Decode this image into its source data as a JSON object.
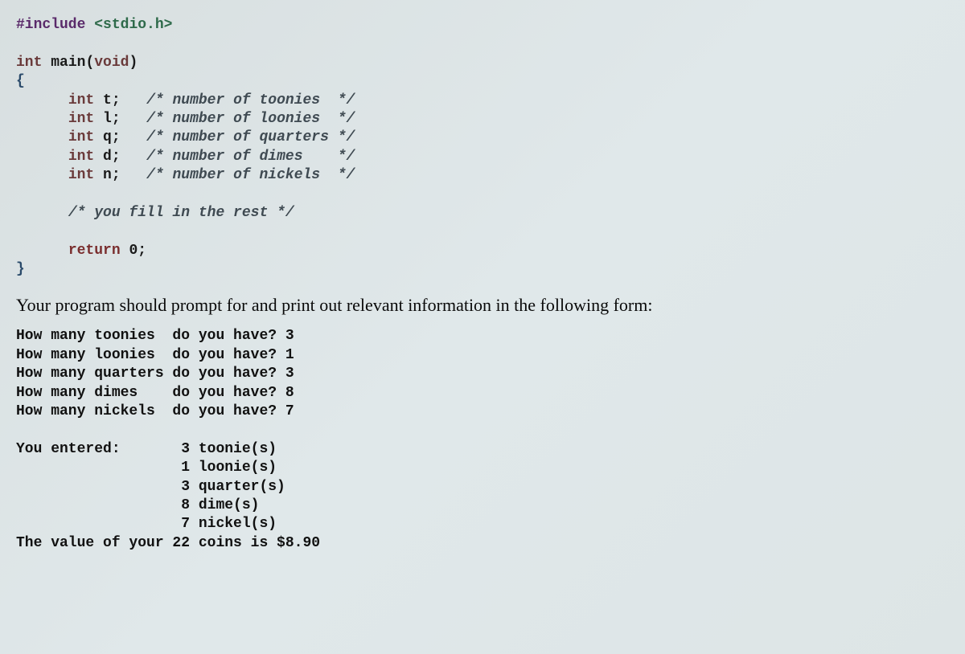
{
  "code": {
    "include_directive": "#include",
    "include_lib": "<stdio.h>",
    "func_type": "int",
    "func_name": "main",
    "func_param_type": "void",
    "open_brace": "{",
    "decl_type": "int",
    "vars": [
      {
        "name": "t",
        "comment": "/* number of toonies  */"
      },
      {
        "name": "l",
        "comment": "/* number of loonies  */"
      },
      {
        "name": "q",
        "comment": "/* number of quarters */"
      },
      {
        "name": "d",
        "comment": "/* number of dimes    */"
      },
      {
        "name": "n",
        "comment": "/* number of nickels  */"
      }
    ],
    "fill_comment": "/* you fill in the rest */",
    "return_kw": "return",
    "return_val": "0;",
    "close_brace": "}"
  },
  "prose": "Your program should prompt for and print out relevant information in the following form:",
  "output": {
    "prompts": [
      "How many toonies  do you have? 3",
      "How many loonies  do you have? 1",
      "How many quarters do you have? 3",
      "How many dimes    do you have? 8",
      "How many nickels  do you have? 7"
    ],
    "entered_label": "You entered:",
    "entered_items": [
      "3 toonie(s)",
      "1 loonie(s)",
      "3 quarter(s)",
      "8 dime(s)",
      "7 nickel(s)"
    ],
    "total_line": "The value of your 22 coins is $8.90"
  }
}
